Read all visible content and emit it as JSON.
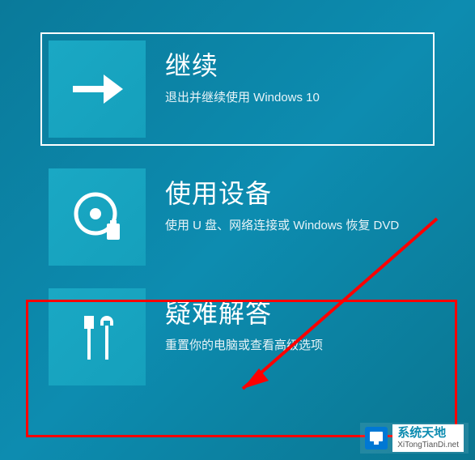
{
  "options": {
    "continue": {
      "title": "继续",
      "subtitle": "退出并继续使用 Windows 10"
    },
    "use_device": {
      "title": "使用设备",
      "subtitle": "使用 U 盘、网络连接或 Windows 恢复 DVD"
    },
    "troubleshoot": {
      "title": "疑难解答",
      "subtitle": "重置你的电脑或查看高级选项"
    }
  },
  "watermark": {
    "name": "系统天地",
    "url": "XiTongTianDi.net"
  }
}
